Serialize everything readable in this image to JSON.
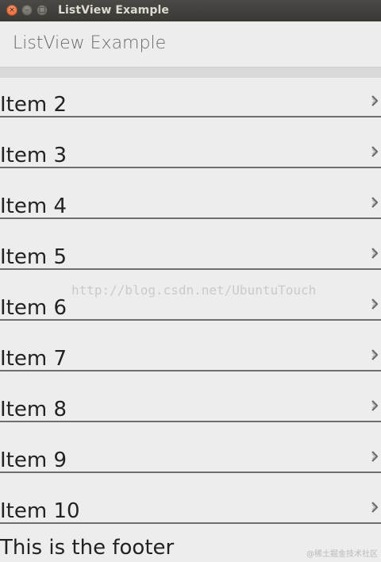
{
  "window": {
    "title": "ListView Example",
    "controls": {
      "close_icon": "×",
      "minimize_icon": "–",
      "maximize_icon": "□"
    }
  },
  "header": {
    "title": "ListView Example"
  },
  "list": {
    "items": [
      {
        "label": "Item 2"
      },
      {
        "label": "Item 3"
      },
      {
        "label": "Item 4"
      },
      {
        "label": "Item 5"
      },
      {
        "label": "Item 6"
      },
      {
        "label": "Item 7"
      },
      {
        "label": "Item 8"
      },
      {
        "label": "Item 9"
      },
      {
        "label": "Item 10"
      }
    ],
    "item_icon": "chevron-right-icon",
    "footer": "This is the footer"
  },
  "watermark": "http://blog.csdn.net/UbuntuTouch",
  "corner_mark": "@稀土掘金技术社区",
  "colors": {
    "titlebar": "#3d3c38",
    "close_button": "#e5622a",
    "background": "#ededed",
    "divider": "#6d6d6d"
  }
}
